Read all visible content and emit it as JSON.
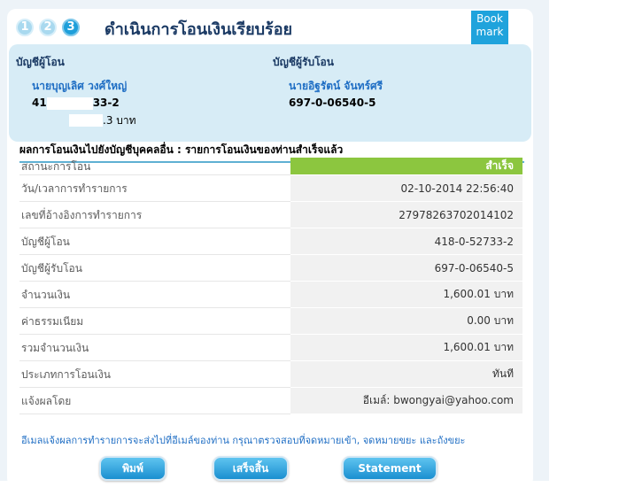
{
  "steps": [
    "1",
    "2",
    "3"
  ],
  "title": "ดำเนินการโอนเงินเรียบร้อย",
  "bookmark": {
    "line1": "Book",
    "line2": "mark"
  },
  "from_account": {
    "heading": "บัญชีผู้โอน",
    "name": "นายบุญเลิศ วงศ์ใหญ่",
    "number_prefix": "41",
    "number_suffix": "33-2",
    "balance_suffix": ".3 บาท"
  },
  "to_account": {
    "heading": "บัญชีผู้รับโอน",
    "name": "นายอิฐรัตน์ จันทร์ศรี",
    "number": "697-0-06540-5"
  },
  "result_heading": "ผลการโอนเงินไปยังบัญชีบุคคลอื่น : รายการโอนเงินของท่านสำเร็จแล้ว",
  "details": [
    {
      "label": "สถานะการโอน",
      "value": "สำเร็จ"
    },
    {
      "label": "วัน/เวลาการทำรายการ",
      "value": "02-10-2014 22:56:40"
    },
    {
      "label": "เลขที่อ้างอิงการทำรายการ",
      "value": "27978263702014102"
    },
    {
      "label": "บัญชีผู้โอน",
      "value": "418-0-52733-2"
    },
    {
      "label": "บัญชีผู้รับโอน",
      "value": "697-0-06540-5"
    },
    {
      "label": "จำนวนเงิน",
      "value": "1,600.01 บาท"
    },
    {
      "label": "ค่าธรรมเนียม",
      "value": "0.00 บาท"
    },
    {
      "label": "รวมจำนวนเงิน",
      "value": "1,600.01 บาท"
    },
    {
      "label": "ประเภทการโอนเงิน",
      "value": "ทันที"
    },
    {
      "label": "แจ้งผลโดย",
      "value": "อีเมล์: bwongyai@yahoo.com"
    }
  ],
  "notice": "อีเมลแจ้งผลการทำรายการจะส่งไปที่อีเมล์ของท่าน กรุณาตรวจสอบที่จดหมายเข้า, จดหมายขยะ และถังขยะ",
  "buttons": {
    "print": "พิมพ์",
    "done": "เสร็จสิ้น",
    "statement": "Statement"
  },
  "colors": {
    "accent": "#1e9fda",
    "status": "#8cc63f",
    "panel": "#d7ecf6"
  }
}
